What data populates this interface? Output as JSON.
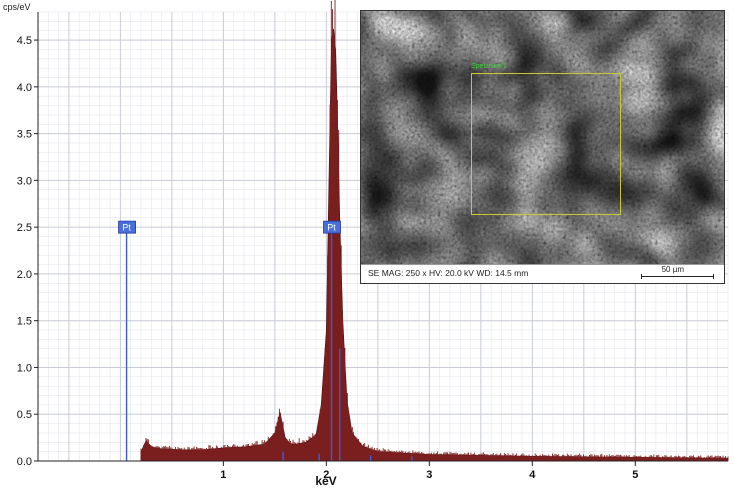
{
  "chart_data": {
    "type": "bar",
    "title": "",
    "xlabel": "keV",
    "ylabel": "cps/eV",
    "xlim": [
      -0.8,
      5.9
    ],
    "ylim": [
      0,
      4.8
    ],
    "x_ticks": [
      1,
      2,
      3,
      4,
      5
    ],
    "x_tick_labels": [
      "1",
      "2",
      "3",
      "4",
      "5"
    ],
    "y_ticks": [
      0.0,
      0.5,
      1.0,
      1.5,
      2.0,
      2.5,
      3.0,
      3.5,
      4.0,
      4.5
    ],
    "y_tick_labels": [
      "0.0",
      "0.5",
      "1.0",
      "1.5",
      "2.0",
      "2.5",
      "3.0",
      "3.5",
      "4.0",
      "4.5"
    ],
    "grid": true,
    "spectrum": {
      "energy": [
        0.2,
        0.25,
        0.3,
        0.4,
        0.6,
        0.8,
        1.0,
        1.2,
        1.4,
        1.5,
        1.55,
        1.6,
        1.65,
        1.7,
        1.8,
        1.9,
        1.95,
        2.0,
        2.03,
        2.05,
        2.07,
        2.09,
        2.11,
        2.13,
        2.16,
        2.2,
        2.25,
        2.35,
        2.5,
        3.0,
        4.0,
        5.0,
        5.9
      ],
      "counts": [
        0.1,
        0.22,
        0.15,
        0.13,
        0.12,
        0.12,
        0.14,
        0.15,
        0.18,
        0.3,
        0.52,
        0.25,
        0.18,
        0.18,
        0.2,
        0.28,
        0.6,
        1.4,
        3.3,
        4.5,
        4.62,
        4.4,
        3.6,
        2.6,
        1.5,
        0.65,
        0.3,
        0.16,
        0.1,
        0.07,
        0.05,
        0.04,
        0.03
      ]
    },
    "peak_markers": [
      {
        "label": "Pt",
        "energy": 0.06,
        "height": 2.5
      },
      {
        "label": "Pt",
        "energy": 2.05,
        "height": 2.5
      },
      {
        "energy": 2.13,
        "height": 1.2
      },
      {
        "energy": 1.58,
        "height": 0.1
      },
      {
        "energy": 1.93,
        "height": 0.08
      },
      {
        "energy": 2.43,
        "height": 0.06
      },
      {
        "energy": 2.83,
        "height": 0.05
      }
    ],
    "colors": {
      "spectrum": "#7a1f1f",
      "marker": "#3b5bdb",
      "grid": "#c9ccd6",
      "label_bg": "#4a6fdc"
    }
  },
  "sem_inset": {
    "caption": "SE  MAG: 250 x  HV: 20.0 kV  WD: 14.5 mm",
    "scale_bar_label": "50 µm",
    "roi_label": "Spectrum 1"
  }
}
